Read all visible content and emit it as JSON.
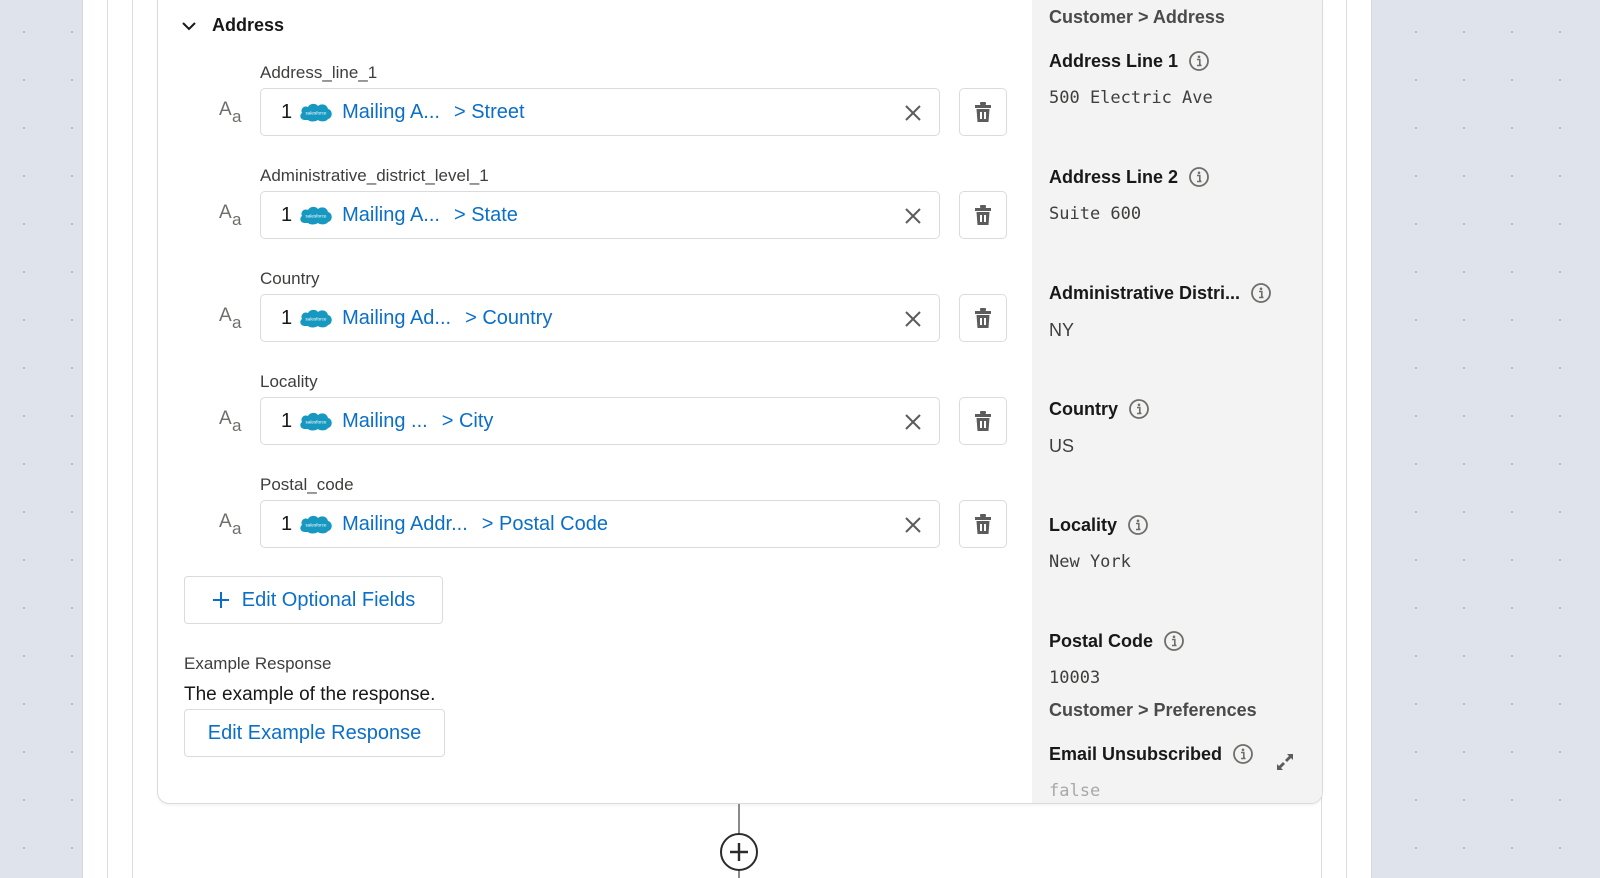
{
  "section": {
    "title": "Address",
    "collapse_icon": "chevron-down-icon"
  },
  "fields": [
    {
      "label": "Address_line_1",
      "type_icon": "text-type-icon",
      "type_glyph_big": "A",
      "type_glyph_small": "a",
      "index": "1",
      "source_icon": "salesforce-cloud-icon",
      "source_label": "salesforce",
      "object": "Mailing A...",
      "field": "> Street"
    },
    {
      "label": "Administrative_district_level_1",
      "type_icon": "text-type-icon",
      "type_glyph_big": "A",
      "type_glyph_small": "a",
      "index": "1",
      "source_icon": "salesforce-cloud-icon",
      "source_label": "salesforce",
      "object": "Mailing A...",
      "field": "> State"
    },
    {
      "label": "Country",
      "type_icon": "text-type-icon",
      "type_glyph_big": "A",
      "type_glyph_small": "a",
      "index": "1",
      "source_icon": "salesforce-cloud-icon",
      "source_label": "salesforce",
      "object": "Mailing Ad...",
      "field": "> Country"
    },
    {
      "label": "Locality",
      "type_icon": "text-type-icon",
      "type_glyph_big": "A",
      "type_glyph_small": "a",
      "index": "1",
      "source_icon": "salesforce-cloud-icon",
      "source_label": "salesforce",
      "object": "Mailing ...",
      "field": "> City"
    },
    {
      "label": "Postal_code",
      "type_icon": "text-type-icon",
      "type_glyph_big": "A",
      "type_glyph_small": "a",
      "index": "1",
      "source_icon": "salesforce-cloud-icon",
      "source_label": "salesforce",
      "object": "Mailing Addr...",
      "field": "> Postal Code"
    }
  ],
  "buttons": {
    "edit_optional_fields": "Edit Optional Fields",
    "edit_optional_icon": "plus-icon",
    "edit_example_response": "Edit Example Response"
  },
  "example_response": {
    "label": "Example Response",
    "text": "The example of the response."
  },
  "preview": {
    "groups": [
      {
        "title": "Customer > Address",
        "fields": [
          {
            "name": "Address Line 1",
            "value": "500 Electric Ave",
            "value_style": "mono"
          },
          {
            "name": "Address Line 2",
            "value": "Suite 600",
            "value_style": "mono"
          },
          {
            "name": "Administrative Distri...",
            "value": "NY",
            "value_style": "sans"
          },
          {
            "name": "Country",
            "value": "US",
            "value_style": "sans"
          },
          {
            "name": "Locality",
            "value": "New York",
            "value_style": "mono"
          },
          {
            "name": "Postal Code",
            "value": "10003",
            "value_style": "mono"
          }
        ]
      },
      {
        "title": "Customer > Preferences",
        "fields": [
          {
            "name": "Email Unsubscribed",
            "value": "false",
            "value_style": "mono-muted"
          }
        ]
      }
    ],
    "expand_icon": "expand-icon"
  },
  "flow": {
    "add_step_icon": "add-circle-icon"
  },
  "colors": {
    "link_blue": "#0b6fc7",
    "salesforce_blue": "#1798c1",
    "canvas_bg": "#dfe3ec",
    "preview_bg": "#f3f3f3"
  }
}
